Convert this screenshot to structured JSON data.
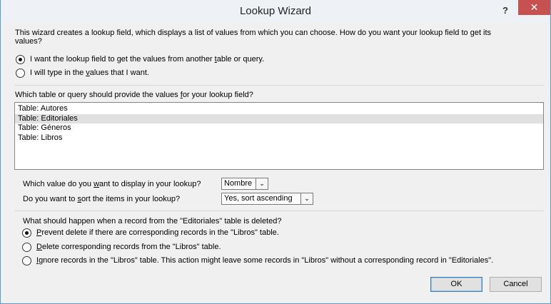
{
  "window": {
    "title": "Lookup Wizard",
    "help": "?",
    "close": "✕"
  },
  "intro": {
    "line1": "This wizard creates a lookup field, which displays a list of values from which you can choose. How do you want your lookup field to get its",
    "line2": "values?",
    "options": [
      {
        "pre": "I want the lookup field to get the values from another ",
        "u": "t",
        "post": "able or query.",
        "checked": true
      },
      {
        "pre": "I will type in the ",
        "u": "v",
        "post": "alues that I want.",
        "checked": false
      }
    ]
  },
  "source": {
    "prompt_pre": "Which table or query should provide the values ",
    "prompt_u": "f",
    "prompt_post": "or your lookup field?",
    "items": [
      "Table: Autores",
      "Table: Editoriales",
      "Table: Géneros",
      "Table: Libros"
    ],
    "selected_index": 1
  },
  "display": {
    "prompt_pre": "Which value do you ",
    "prompt_u": "w",
    "prompt_post": "ant to display in your lookup?",
    "value": "Nombre"
  },
  "sort": {
    "prompt_pre": "Do you want to ",
    "prompt_u": "s",
    "prompt_post": "ort the items in your lookup?",
    "value": "Yes, sort ascending"
  },
  "delete": {
    "prompt": "What should happen when a record from the \"Editoriales\" table is deleted?",
    "options": [
      {
        "pre": "",
        "u": "P",
        "post": "revent delete if there are corresponding records in the \"Libros\" table.",
        "checked": true
      },
      {
        "pre": "",
        "u": "D",
        "post": "elete corresponding records from the \"Libros\" table.",
        "checked": false
      },
      {
        "pre": "",
        "u": "I",
        "post": "gnore records in the \"Libros\" table. This action might leave some records in \"Libros\" without a corresponding record in \"Editoriales\".",
        "checked": false
      }
    ]
  },
  "buttons": {
    "ok": "OK",
    "cancel": "Cancel"
  }
}
